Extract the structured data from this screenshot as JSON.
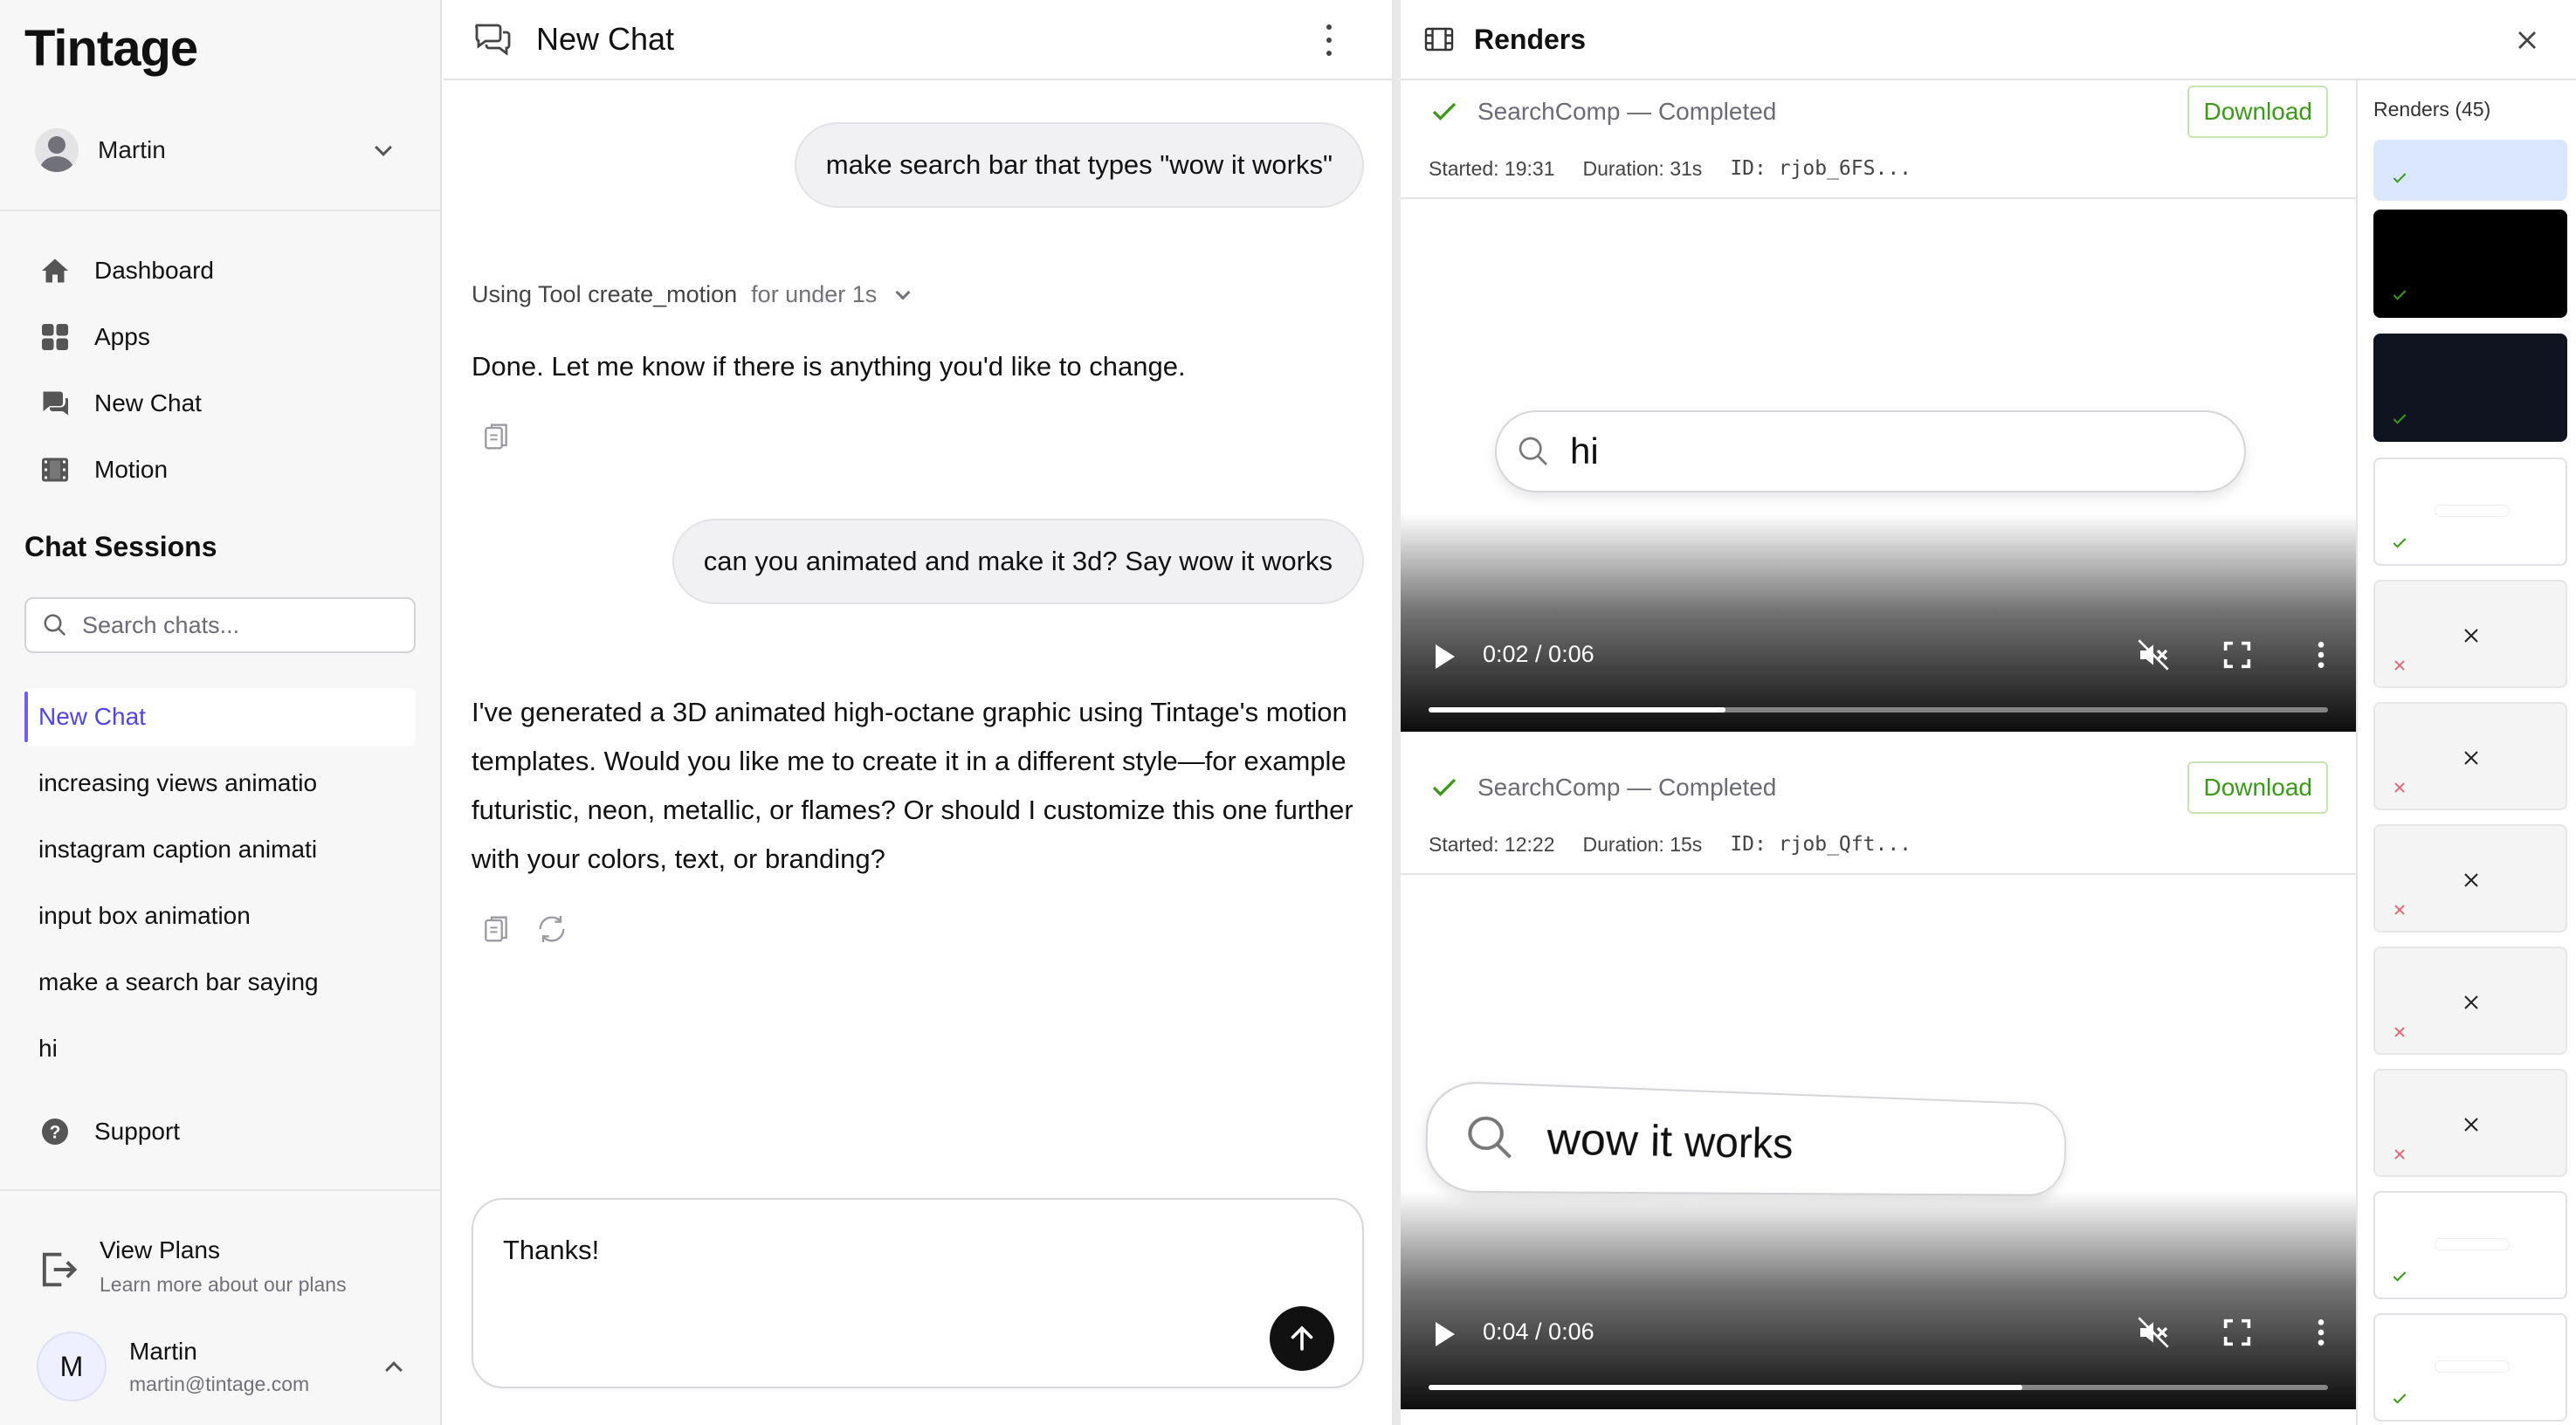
{
  "app": {
    "brand": "Tintage"
  },
  "sidebar": {
    "user_name": "Martin",
    "nav": [
      {
        "label": "Dashboard",
        "icon": "home-icon"
      },
      {
        "label": "Apps",
        "icon": "grid-icon"
      },
      {
        "label": "New Chat",
        "icon": "chat-icon"
      },
      {
        "label": "Motion",
        "icon": "film-icon"
      }
    ],
    "sessions_title": "Chat Sessions",
    "search_placeholder": "Search chats...",
    "sessions": [
      "New Chat",
      "increasing views animatio",
      "instagram caption animati",
      "input box animation",
      "make a search bar saying",
      "hi"
    ],
    "support_label": "Support",
    "plans_title": "View Plans",
    "plans_subtitle": "Learn more about our plans",
    "account_initial": "M",
    "account_name": "Martin",
    "account_email": "martin@tintage.com"
  },
  "chat": {
    "title": "New Chat",
    "user_msg_1": "make search bar that types \"wow it works\"",
    "tool_name": "Using Tool create_motion",
    "tool_duration": "for under 1s",
    "assistant_msg_1": "Done. Let me know if there is anything you'd like to change.",
    "user_msg_2": "can you animated and make it 3d? Say wow it works",
    "assistant_msg_2": "I've generated a 3D animated high-octane graphic using Tintage's motion templates. Would you like me to create it in a different style—for example futuristic, neon, metallic, or flames? Or should I customize this one further with your colors, text, or branding?",
    "composer_text": "Thanks!"
  },
  "renders": {
    "title": "Renders",
    "list_label": "Renders (45)",
    "jobs": [
      {
        "status": "SearchComp — Completed",
        "download": "Download",
        "started": "Started: 19:31",
        "duration": "Duration: 31s",
        "id": "ID: rjob_6FS...",
        "time": "0:02 / 0:06",
        "progress": 0.33,
        "preview_text": "hi"
      },
      {
        "status": "SearchComp — Completed",
        "download": "Download",
        "started": "Started: 12:22",
        "duration": "Duration: 15s",
        "id": "ID: rjob_Qft...",
        "time": "0:04 / 0:06",
        "progress": 0.66,
        "preview_text": "wow it works"
      }
    ],
    "thumbnails": [
      "selected-success",
      "black-success",
      "navy-success",
      "blank-success",
      "failed",
      "failed",
      "failed",
      "failed",
      "failed",
      "blank-success",
      "blank-success"
    ]
  },
  "colors": {
    "accent": "#4f46e5",
    "success": "#3a9a18",
    "error": "#e05a6a"
  }
}
